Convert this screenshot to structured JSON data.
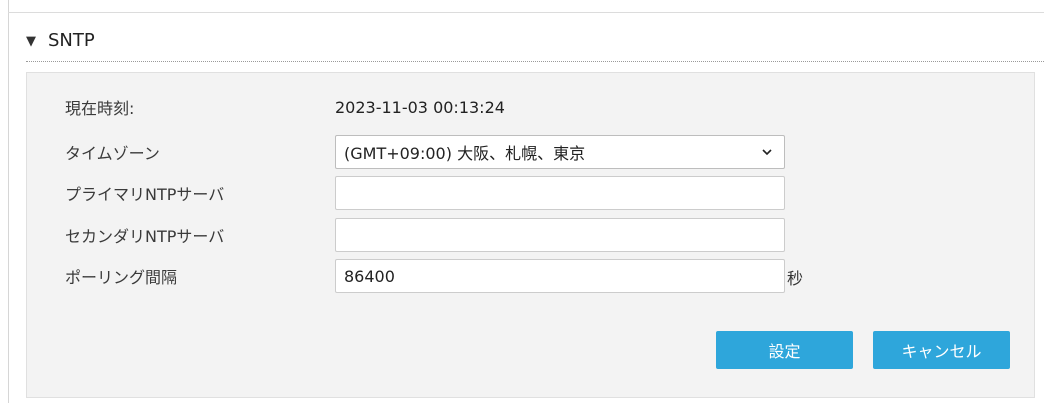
{
  "section": {
    "title": "SNTP",
    "toggle_icon": "collapse-triangle-down"
  },
  "form": {
    "current_time_label": "現在時刻:",
    "current_time_value": "2023-11-03 00:13:24",
    "timezone_label": "タイムゾーン",
    "timezone_value": "(GMT+09:00) 大阪、札幌、東京",
    "primary_ntp_label": "プライマリNTPサーバ",
    "primary_ntp_value": "",
    "secondary_ntp_label": "セカンダリNTPサーバ",
    "secondary_ntp_value": "",
    "polling_label": "ポーリング間隔",
    "polling_value": "86400",
    "polling_unit": "秒"
  },
  "buttons": {
    "apply_label": "設定",
    "cancel_label": "キャンセル"
  },
  "colors": {
    "button": "#2ea6db",
    "panel_bg": "#f3f3f3"
  }
}
